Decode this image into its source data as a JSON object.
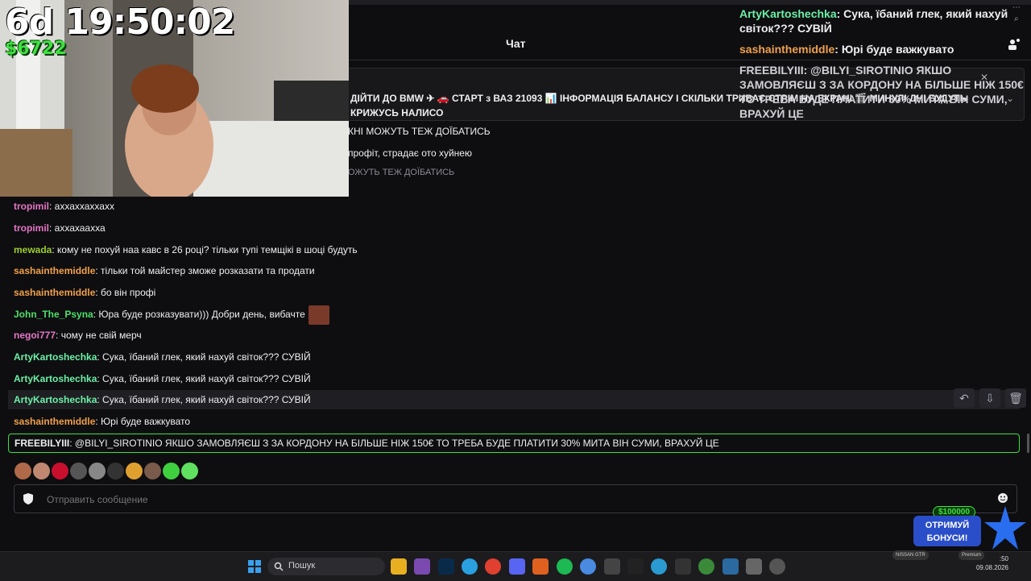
{
  "overlay": {
    "timer": "6d 19:50:02",
    "balance": "$6722",
    "lines": [
      {
        "user": "ArtyKartoshechka",
        "text": ": Сука, їбаний глек, який нахуй світок??? СУВІЙ",
        "color": "#6cf0a7"
      },
      {
        "user": "sashainthemiddle",
        "text": ": Юрі буде важкувато",
        "color": "#f0a04b"
      },
      {
        "user": "FREEBILYIII",
        "text": ": @BILYI_SIROTINIO ЯКШО ЗАМОВЛЯЄШ З ЗА КОРДОНУ НА БІЛЬШЕ НІЖ 150€ ТО ТРЕБА БУДЕ ПЛАТИТИ 30% МИТА ВІН СУМИ, ВРАХУЙ ЦЕ",
        "color": "#efeff1"
      }
    ],
    "fragment": "СТРІМ НА ЕКРАН!  МИНУЛІ дні БУДУТЬ"
  },
  "header": {
    "title": "Чат"
  },
  "pinned": {
    "text": "ДІЙТИ ДО BMW ✈ 🚗 СТАРТ з ВАЗ 21093 📊 ІНФОРМАЦІЯ БАЛАНСУ І СКІЛЬКИ ТРИВАЄ СТРІМ НА ЕКРАНІ 🎬 МИНУЛІ ДНІ БУДУТЬ\nКРИЖУСЬ НАЛИСО"
  },
  "ghost_lines": [
    "КНІ МОЖУТЬ ТЕЖ ДОЇБАТИСЬ",
    "профіт, страдає ото хуйнею",
    "ОЖУТЬ ТЕЖ ДОЇБАТИСЬ"
  ],
  "messages": [
    {
      "user": "tropimil",
      "text": ": аххаххаххахх",
      "color": "#e576c6"
    },
    {
      "user": "tropimil",
      "text": ": аххахаахха",
      "color": "#e576c6"
    },
    {
      "user": "mewada",
      "text": ": кому не похуй наа кавс в 26 році? тільки тупі темщікі в шоці будуть",
      "color": "#9acd32"
    },
    {
      "user": "sashainthemiddle",
      "text": ": тільки той майстер зможе розказати та продати",
      "color": "#f0a04b"
    },
    {
      "user": "sashainthemiddle",
      "text": ": бо він профі",
      "color": "#f0a04b"
    },
    {
      "user": "John_The_Psyna",
      "text": ": Юра буде розказувати))) Добри день, вибачте",
      "color": "#4ee06a"
    },
    {
      "user": "negoi777",
      "text": ": чому не свій мерч",
      "color": "#e576c6"
    },
    {
      "user": "ArtyKartoshechka",
      "text": ": Сука, їбаний глек, який нахуй світок??? СУВІЙ",
      "color": "#6cf0a7"
    },
    {
      "user": "ArtyKartoshechka",
      "text": ": Сука, їбаний глек, який нахуй світок??? СУВІЙ",
      "color": "#6cf0a7"
    },
    {
      "user": "ArtyKartoshechka",
      "text": ": Сука, їбаний глек, який нахуй світок??? СУВІЙ",
      "color": "#6cf0a7"
    },
    {
      "user": "sashainthemiddle",
      "text": ": Юрі буде важкувато",
      "color": "#f0a04b"
    },
    {
      "user": "FREEBILYIII",
      "text": ": @BILYI_SIROTINIO ЯКШО ЗАМОВЛЯЄШ З ЗА КОРДОНУ НА БІЛЬШЕ НІЖ 150€ ТО ТРЕБА БУДЕ ПЛАТИТИ 30% МИТА ВІН СУМИ, ВРАХУЙ ЦЕ",
      "color": "#efeff1"
    }
  ],
  "input": {
    "placeholder": "Отправить сообщение"
  },
  "bonus": {
    "amount": "$100000",
    "line1": "ОТРИМУЙ",
    "line2": "БОНУСИ!"
  },
  "taskbar": {
    "search_label": "Пошук",
    "tray_car": "NISSAN GTR",
    "tray_premium": "Premium",
    "time": ":50",
    "date": "09.08.2026"
  },
  "colors": {
    "accent_green": "#3fe042",
    "bg": "#0e0e10"
  }
}
